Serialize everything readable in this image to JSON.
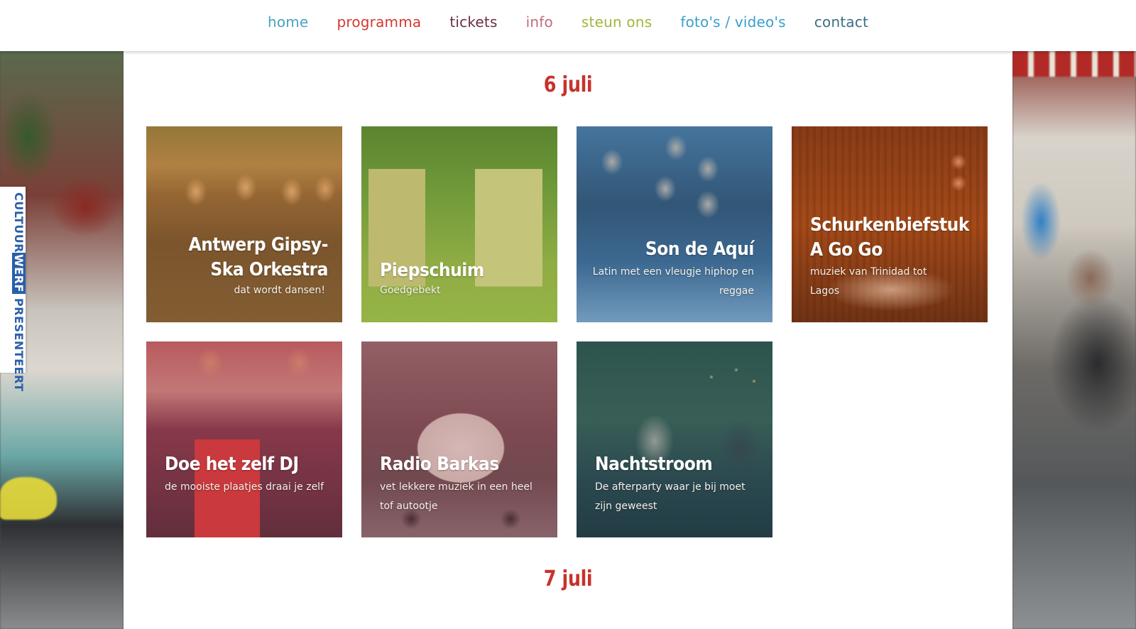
{
  "nav": [
    {
      "label": "home",
      "color": "#4aa2c4"
    },
    {
      "label": "programma",
      "color": "#d23a2f"
    },
    {
      "label": "tickets",
      "color": "#6a2f45"
    },
    {
      "label": "info",
      "color": "#c06d7d"
    },
    {
      "label": "steun ons",
      "color": "#a3b63b"
    },
    {
      "label": "foto's / video's",
      "color": "#3a9ecf"
    },
    {
      "label": "contact",
      "color": "#3b6f86"
    }
  ],
  "side_tag": {
    "before": "CULTUUR",
    "highlight": "WERF",
    "after": " PRESENTEERT"
  },
  "days": [
    "6 juli",
    "7 juli"
  ],
  "cards": [
    {
      "title": "Antwerp Gipsy-Ska Orkestra",
      "subtitle": "dat wordt dansen!",
      "photo": "band-photo",
      "tint": "#c98a3a"
    },
    {
      "title": "Piepschuim",
      "subtitle": "Goedgebekt",
      "photo": "wooden-booths-photo",
      "tint": "#9bbf3a"
    },
    {
      "title": "Son de Aquí",
      "subtitle": "Latin met een vleugje hiphop en reggae",
      "photo": "group-selfie-photo",
      "tint": "#3b8fc9"
    },
    {
      "title": "Schurkenbiefstuk A Go Go",
      "subtitle": "muziek van Trinidad tot Lagos",
      "photo": "stage-car-photo",
      "tint": "#d0652e"
    },
    {
      "title": "Doe het zelf DJ",
      "subtitle": "de mooiste plaatjes draai je zelf",
      "photo": "dj-booth-photo",
      "tint": "#b9384d"
    },
    {
      "title": "Radio Barkas",
      "subtitle": "vet lekkere muziek in een heel tof autootje",
      "photo": "small-van-photo",
      "tint": "#a84a5e"
    },
    {
      "title": "Nachtstroom",
      "subtitle": "De afterparty waar je bij moet zijn geweest",
      "photo": "night-party-photo",
      "tint": "#2f5f6e"
    }
  ]
}
